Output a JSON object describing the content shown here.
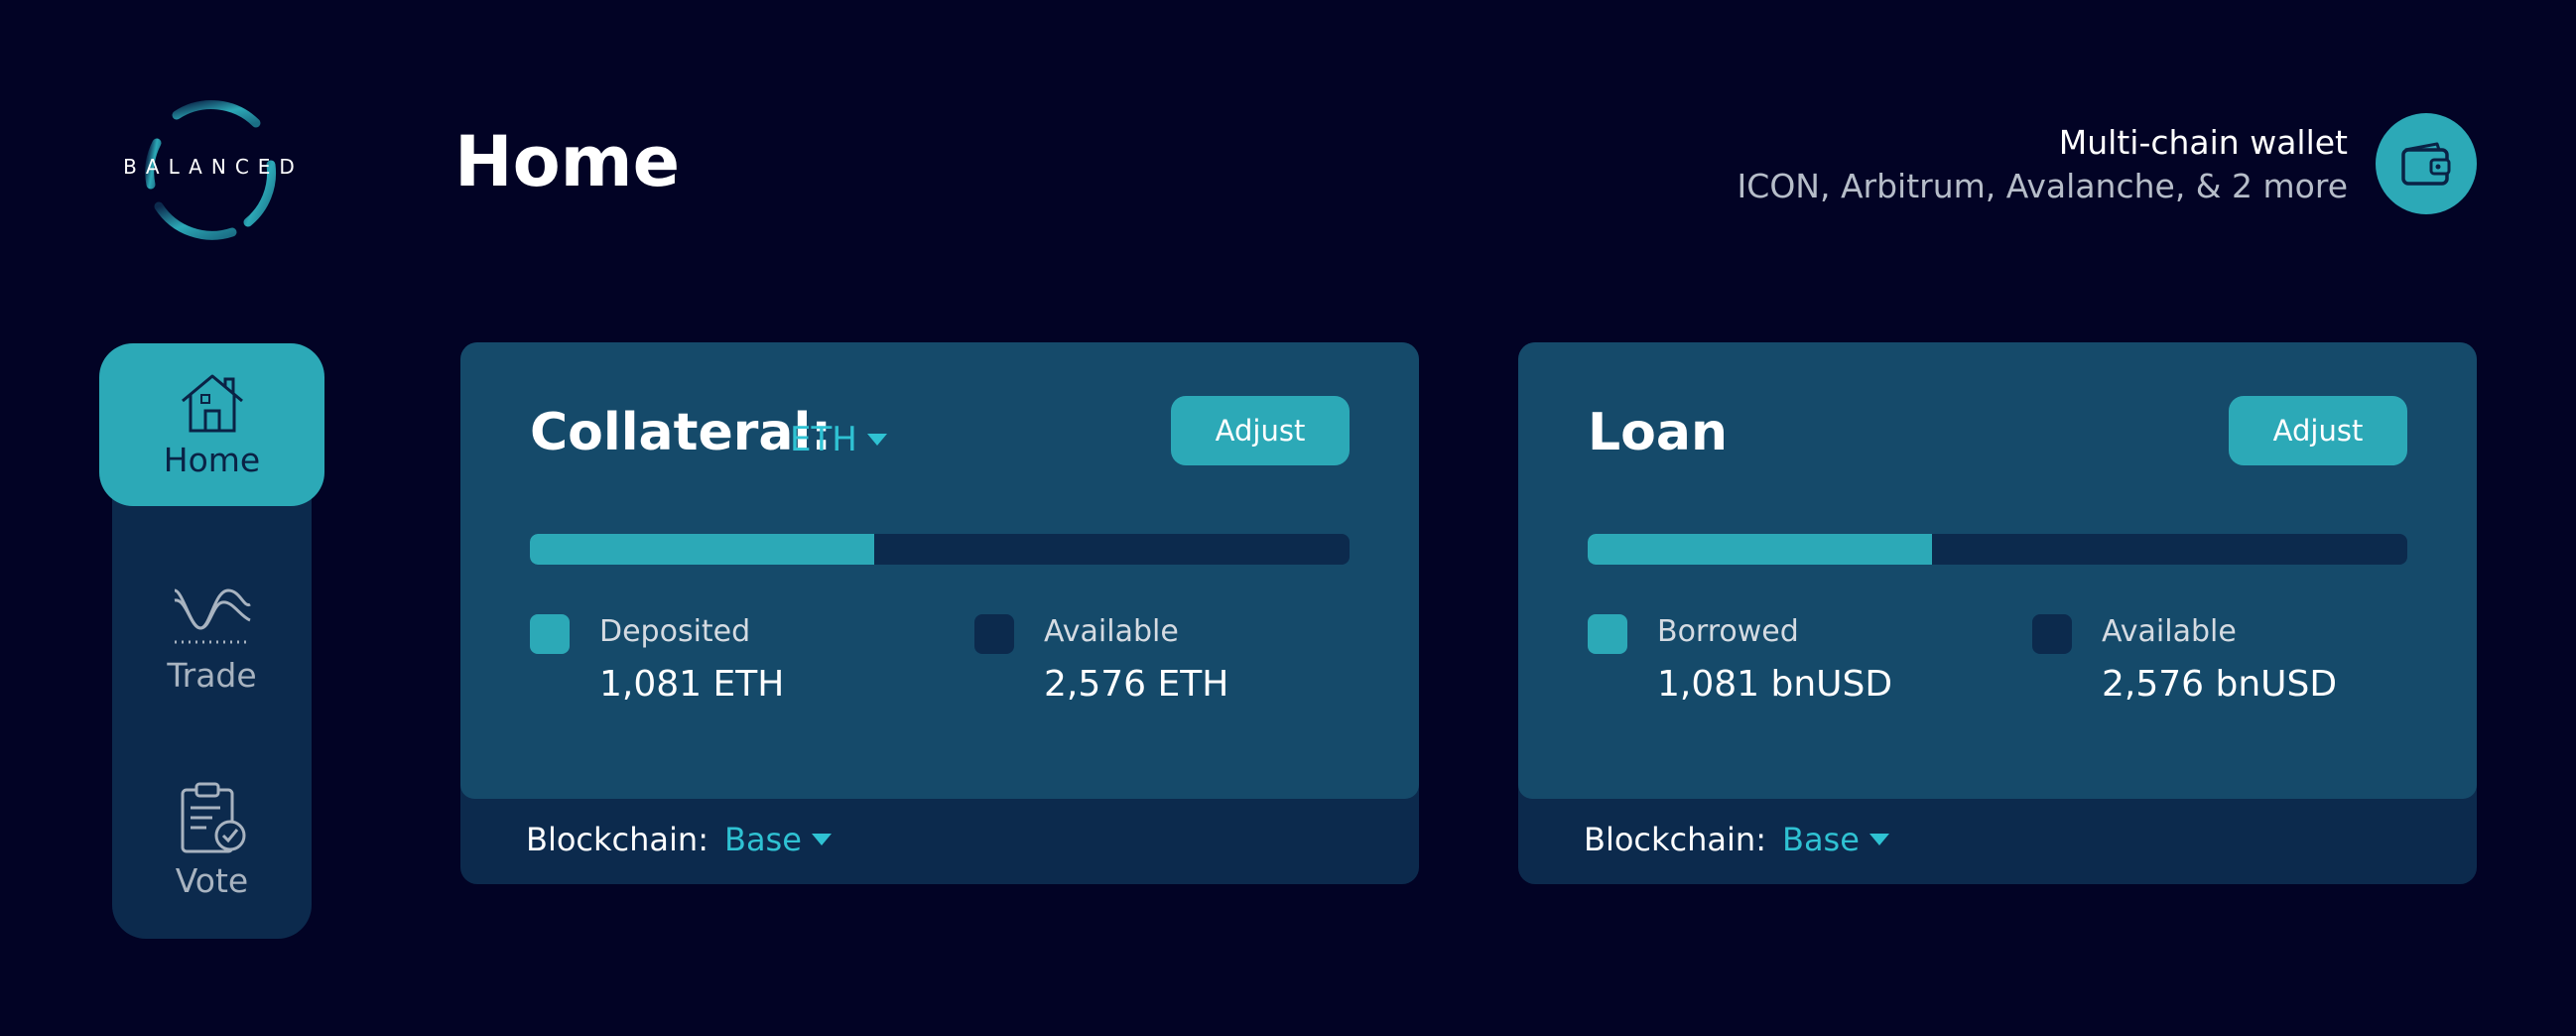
{
  "brand": {
    "logo_text": "BALANCED",
    "accent": "#2CA9B7",
    "background": "#020325",
    "panel": "#0C2A4D",
    "card": "#154A6A"
  },
  "header": {
    "title": "Home"
  },
  "wallet": {
    "title": "Multi-chain wallet",
    "chains": "ICON, Arbitrum, Avalanche, & 2 more",
    "icon": "wallet-icon"
  },
  "sidebar": {
    "items": [
      {
        "label": "Home",
        "icon": "home-icon",
        "active": true
      },
      {
        "label": "Trade",
        "icon": "trade-icon",
        "active": false
      },
      {
        "label": "Vote",
        "icon": "vote-icon",
        "active": false
      }
    ]
  },
  "collateral": {
    "title": "Collateral:",
    "asset": "ETH",
    "adjust_label": "Adjust",
    "progress_fraction": 0.42,
    "deposited_label": "Deposited",
    "deposited_value": "1,081 ETH",
    "available_label": "Available",
    "available_value": "2,576 ETH",
    "blockchain_label": "Blockchain:",
    "blockchain_value": "Base"
  },
  "loan": {
    "title": "Loan",
    "adjust_label": "Adjust",
    "progress_fraction": 0.42,
    "borrowed_label": "Borrowed",
    "borrowed_value": "1,081 bnUSD",
    "available_label": "Available",
    "available_value": "2,576 bnUSD",
    "blockchain_label": "Blockchain:",
    "blockchain_value": "Base"
  }
}
